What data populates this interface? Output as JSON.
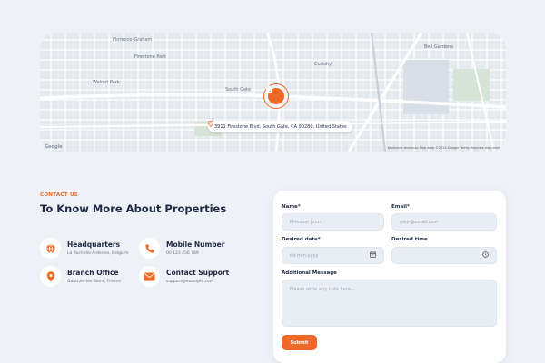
{
  "map": {
    "address": "3911 Firestone Blvd, South Gate, CA 90280, United States",
    "labels": {
      "florence": "Florence-Graham",
      "firestone": "Firestone Park",
      "walnut": "Walnut Park",
      "south_gate": "South Gate",
      "cudahy": "Cudahy",
      "bell_gardens": "Bell Gardens"
    },
    "attribution": "Keyboard shortcuts   Map data ©2024 Google   Terms   Report a map error",
    "logo": "Google"
  },
  "contact": {
    "eyebrow": "CONTACT US",
    "heading": "To Know More About Properties",
    "items": [
      {
        "title": "Headquarters",
        "subtitle": "La Rochelle-Ardenne, Belgium",
        "icon": "globe-icon"
      },
      {
        "title": "Mobile Number",
        "subtitle": "00 123 456 789",
        "icon": "phone-icon"
      },
      {
        "title": "Branch Office",
        "subtitle": "Gauthier-les-Bains, France",
        "icon": "location-pin-icon"
      },
      {
        "title": "Contact Support",
        "subtitle": "support@example.com",
        "icon": "mail-icon"
      }
    ]
  },
  "form": {
    "name_label": "Name*",
    "name_placeholder": "Mimosor John",
    "email_label": "Email*",
    "email_placeholder": "your@email.com",
    "date_label": "Desired date*",
    "date_placeholder": "dd-mm-yyyy",
    "time_label": "Desired time",
    "message_label": "Additional Message",
    "message_placeholder": "Please write any note here...",
    "submit_label": "Submit"
  },
  "colors": {
    "accent": "#ee6a28",
    "background": "#eef1f6",
    "heading": "#1f2a44"
  }
}
